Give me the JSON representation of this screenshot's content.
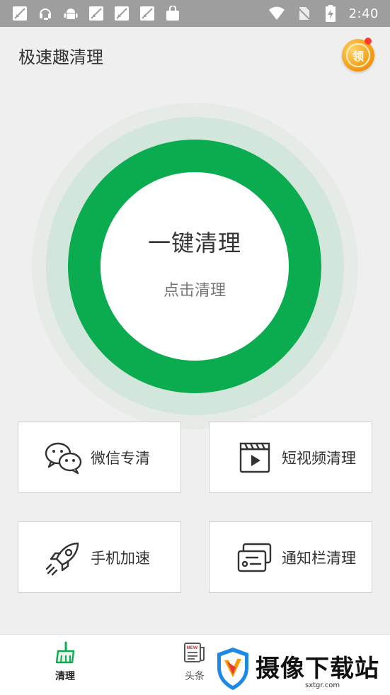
{
  "status_bar": {
    "time": "2:40",
    "left_icons": [
      "signal-slash-icon",
      "headset-icon",
      "android-icon",
      "signal-slash-icon",
      "signal-slash-icon",
      "signal-slash-icon",
      "bag-icon"
    ],
    "right_icons": [
      "wifi-icon",
      "no-sim-icon",
      "battery-charging-icon"
    ]
  },
  "header": {
    "title": "极速趣清理",
    "reward_label": "领"
  },
  "main_button": {
    "title": "一键清理",
    "subtitle": "点击清理"
  },
  "features": [
    {
      "label": "微信专清",
      "icon": "wechat-icon"
    },
    {
      "label": "短视频清理",
      "icon": "video-clapper-icon"
    },
    {
      "label": "手机加速",
      "icon": "rocket-icon"
    },
    {
      "label": "通知栏清理",
      "icon": "notification-card-icon"
    }
  ],
  "bottom_nav": {
    "items": [
      {
        "label": "清理",
        "icon": "broom-icon",
        "active": true
      },
      {
        "label": "头条",
        "icon": "news-icon",
        "active": false
      }
    ]
  },
  "watermark": {
    "text": "摄像下载站",
    "url": "sxtgr.com"
  },
  "colors": {
    "accent": "#0bab4f",
    "halo": "#d3e6db",
    "status_bar": "#9e9e9e"
  }
}
